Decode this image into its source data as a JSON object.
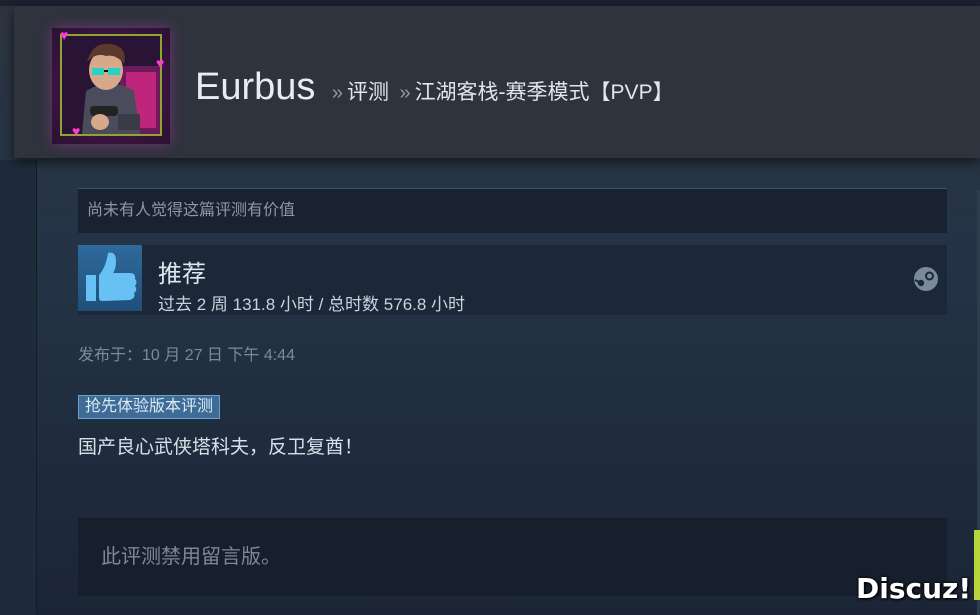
{
  "header": {
    "username": "Eurbus",
    "separator": "»",
    "crumb_reviews": "评测",
    "crumb_game": "江湖客栈-赛季模式【PVP】"
  },
  "review": {
    "helpful_text": "尚未有人觉得这篇评测有价值",
    "recommendation": "推荐",
    "hours": "过去 2 周 131.8 小时 / 总时数 576.8 小时",
    "posted": "发布于：10 月 27 日 下午 4:44",
    "early_access_badge": "抢先体验版本评测",
    "body": "国产良心武侠塔科夫，反卫复酋！",
    "comments_disabled": "此评测禁用留言版。"
  },
  "watermark": "Discuz!",
  "colors": {
    "header_bg": "#2f333d",
    "badge_bg": "#3e6c97",
    "thumb_bg": "#2e6a9b",
    "avatar_glow": "#ff3bd2"
  },
  "icons": [
    "thumbs-up-icon",
    "steam-logo-icon",
    "heart-icon"
  ]
}
